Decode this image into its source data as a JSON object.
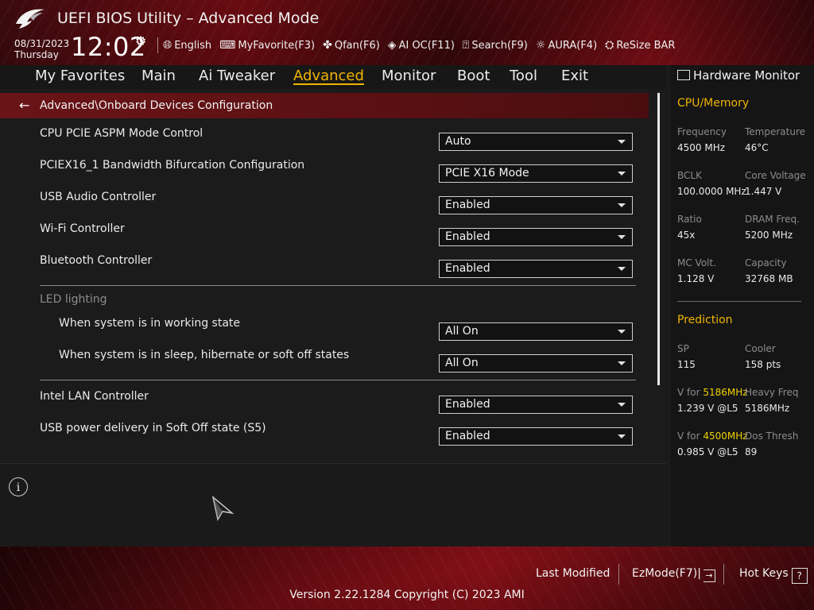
{
  "header": {
    "title": "UEFI BIOS Utility – Advanced Mode",
    "date": "08/31/2023",
    "day": "Thursday",
    "time": "12:02",
    "toolbar": [
      {
        "icon": "globe-icon",
        "label": "English"
      },
      {
        "icon": "star-keyboard-icon",
        "label": "MyFavorite(F3)"
      },
      {
        "icon": "fan-icon",
        "label": "Qfan(F6)"
      },
      {
        "icon": "ai-chip-icon",
        "label": "AI OC(F11)"
      },
      {
        "icon": "search-question-icon",
        "label": "Search(F9)"
      },
      {
        "icon": "aura-light-icon",
        "label": "AURA(F4)"
      },
      {
        "icon": "resize-bar-icon",
        "label": "ReSize BAR"
      }
    ]
  },
  "nav": {
    "tabs": [
      "My Favorites",
      "Main",
      "Ai Tweaker",
      "Advanced",
      "Monitor",
      "Boot",
      "Tool",
      "Exit"
    ],
    "active": "Advanced"
  },
  "breadcrumb": "Advanced\\Onboard Devices Configuration",
  "settings": [
    {
      "label": "CPU PCIE ASPM Mode Control",
      "value": "Auto"
    },
    {
      "label": "PCIEX16_1 Bandwidth Bifurcation Configuration",
      "value": "PCIE X16 Mode"
    },
    {
      "label": "USB Audio Controller",
      "value": "Enabled"
    },
    {
      "label": "Wi-Fi Controller",
      "value": "Enabled"
    },
    {
      "label": "Bluetooth Controller",
      "value": "Enabled"
    }
  ],
  "led_group": {
    "title": "LED lighting",
    "items": [
      {
        "label": "When system is in working state",
        "value": "All On"
      },
      {
        "label": "When system is in sleep, hibernate or soft off states",
        "value": "All On"
      }
    ]
  },
  "settings2": [
    {
      "label": "Intel LAN Controller",
      "value": "Enabled"
    },
    {
      "label": "USB power delivery in Soft Off state (S5)",
      "value": "Enabled"
    }
  ],
  "hardware_monitor": {
    "title": "Hardware Monitor",
    "cpu_memory": {
      "title": "CPU/Memory",
      "items": [
        {
          "key": "Frequency",
          "value": "4500 MHz"
        },
        {
          "key": "Temperature",
          "value": "46°C"
        },
        {
          "key": "BCLK",
          "value": "100.0000 MHz"
        },
        {
          "key": "Core Voltage",
          "value": "1.447 V"
        },
        {
          "key": "Ratio",
          "value": "45x"
        },
        {
          "key": "DRAM Freq.",
          "value": "5200 MHz"
        },
        {
          "key": "MC Volt.",
          "value": "1.128 V"
        },
        {
          "key": "Capacity",
          "value": "32768 MB"
        }
      ]
    },
    "prediction": {
      "title": "Prediction",
      "sp_key": "SP",
      "sp_value": "115",
      "cooler_key": "Cooler",
      "cooler_value": "158 pts",
      "v1_prefix": "V for ",
      "v1_freq": "5186MHz",
      "v1_value": "1.239 V @L5",
      "heavy_key": "Heavy Freq",
      "heavy_value": "5186MHz",
      "v2_prefix": "V for ",
      "v2_freq": "4500MHz",
      "v2_value": "0.985 V @L5",
      "dos_key": "Dos Thresh",
      "dos_value": "89"
    }
  },
  "footer": {
    "last_modified": "Last Modified",
    "ezmode": "EzMode(F7)",
    "hotkeys": "Hot Keys",
    "hotkeys_glyph": "?",
    "version": "Version 2.22.1284 Copyright (C) 2023 AMI"
  },
  "colors": {
    "accent": "#f0b400",
    "highlight": "#f0d000",
    "brand_red": "#7a0d14"
  }
}
